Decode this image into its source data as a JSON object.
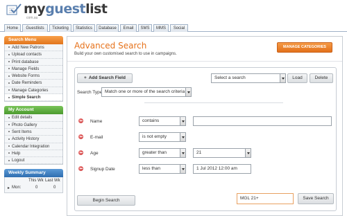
{
  "app": {
    "logo_text_a": "my",
    "logo_text_b": "guest",
    "logo_text_c": "list",
    "logo_sub": "com.au"
  },
  "nav": {
    "tabs": [
      "Home",
      "Guestlists",
      "Ticketing",
      "Statistics",
      "Database",
      "Email",
      "SMS",
      "MMS",
      "Social"
    ]
  },
  "sidebar": {
    "search_menu": {
      "title": "Search Menu",
      "items": [
        "Add New Patrons",
        "Upload contacts",
        "Print database",
        "Manage Fields",
        "Website Forms",
        "Date Reminders",
        "Manage Categories",
        "Simple Search"
      ]
    },
    "my_account": {
      "title": "My Account",
      "items": [
        "Edit details",
        "Photo Gallery",
        "Sent Items",
        "Activity History",
        "Calendar Integration",
        "Help",
        "Logout"
      ]
    },
    "weekly": {
      "title": "Weekly Summary",
      "col1": "This Wk",
      "col2": "Last Wk",
      "row_label": "Mon:",
      "val1": "0",
      "val2": "0"
    }
  },
  "main": {
    "title": "Advanced Search",
    "subtitle": "Build your own customised search to use in campaigns.",
    "manage_button": "MANAGE CATEGORIES",
    "add_field_button": "Add Search Field",
    "saved_search_select": "Select a search",
    "load_button": "Load",
    "delete_button": "Delete",
    "search_type_label": "Search Type:",
    "search_type_value": "Match one or more of the search criteria",
    "rows": [
      {
        "field": "Name",
        "op": "contains",
        "value": ""
      },
      {
        "field": "E-mail",
        "op": "is not empty",
        "value": ""
      },
      {
        "field": "Age",
        "op": "greater than",
        "value": "21"
      },
      {
        "field": "Signup Date",
        "op": "less than",
        "value": "1 Jul 2012 12:00 am"
      }
    ],
    "begin_button": "Begin Search",
    "save_name": "MGL 21+",
    "save_button": "Save Search"
  },
  "colors": {
    "accent": "#e6721b",
    "nav_border": "#9fb1c6",
    "green": "#4b9a2e",
    "blue": "#2f6eb0"
  }
}
